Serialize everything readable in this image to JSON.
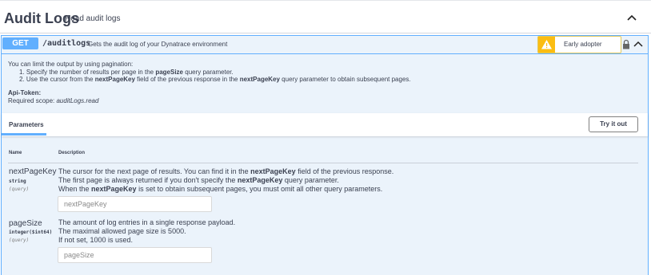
{
  "section": {
    "title": "Audit Logs",
    "description": "Read audit logs"
  },
  "operation": {
    "method": "GET",
    "path": "/auditlogs",
    "summary": "Gets the audit log of your Dynatrace environment",
    "badge": "Early adopter",
    "description": {
      "intro": "You can limit the output by using pagination:",
      "step1_pre": "1. Specify the number of results per page in the ",
      "step1_b": "pageSize",
      "step1_post": " query parameter.",
      "step2_pre": "2. Use the cursor from the ",
      "step2_b1": "nextPageKey",
      "step2_mid": " field of the previous response in the ",
      "step2_b2": "nextPageKey",
      "step2_post": " query parameter to obtain subsequent pages."
    },
    "api_token_label": "Api-Token:",
    "scope_pre": "Required scope: ",
    "scope_value": "auditLogs.read"
  },
  "params": {
    "tab_label": "Parameters",
    "try_label": "Try it out",
    "col_name": "Name",
    "col_desc": "Description",
    "items": [
      {
        "name": "nextPageKey",
        "type": "string",
        "in": "(query)",
        "l1_pre": "The cursor for the next page of results. You can find it in the ",
        "l1_b": "nextPageKey",
        "l1_post": " field of the previous response.",
        "l2_pre": "The first page is always returned if you don't specify the ",
        "l2_b": "nextPageKey",
        "l2_post": " query parameter.",
        "l3_pre": "When the ",
        "l3_b": "nextPageKey",
        "l3_post": " is set to obtain subsequent pages, you must omit all other query parameters.",
        "placeholder": "nextPageKey"
      },
      {
        "name": "pageSize",
        "type": "integer($int64)",
        "in": "(query)",
        "l1": "The amount of log entries in a single response payload.",
        "l2": "The maximal allowed page size is 5000.",
        "l3": "If not set, 1000 is used.",
        "placeholder": "pageSize"
      }
    ]
  },
  "colors": {
    "get": "#61affe",
    "warn": "#fbbd12",
    "text": "#3b4151"
  }
}
